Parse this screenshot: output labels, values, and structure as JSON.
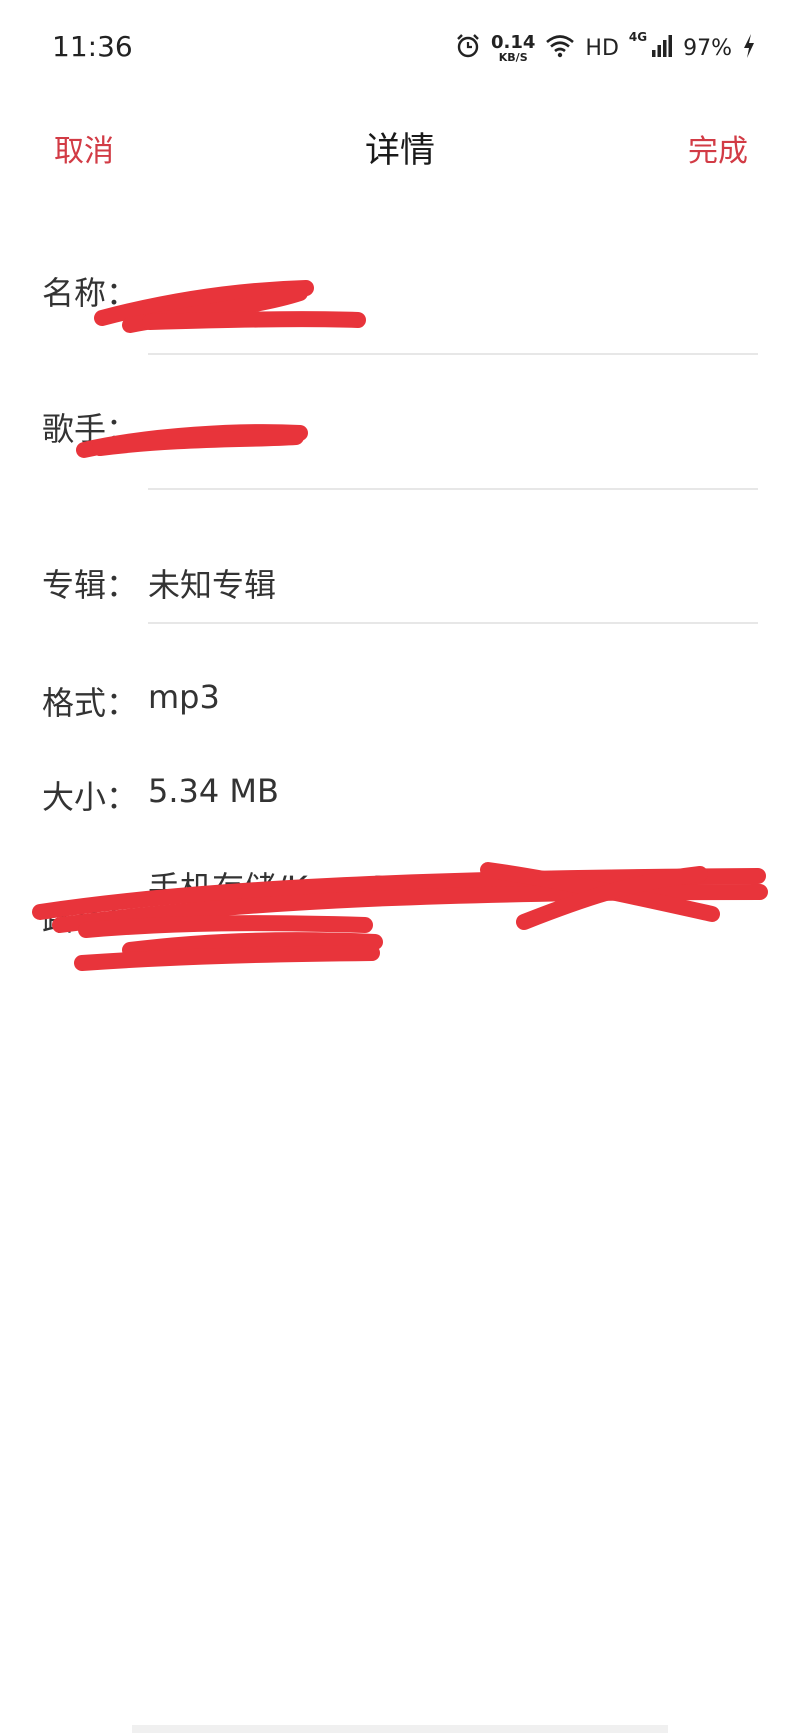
{
  "status_bar": {
    "time": "11:36",
    "speed_value": "0.14",
    "speed_unit": "KB/S",
    "hd": "HD",
    "network": "4G",
    "battery": "97%"
  },
  "nav": {
    "cancel": "取消",
    "title": "详情",
    "done": "完成"
  },
  "fields": {
    "name": {
      "label": "名称：",
      "value": ""
    },
    "artist": {
      "label": "歌手：",
      "value": ""
    },
    "album": {
      "label": "专辑：",
      "value": "未知专辑"
    },
    "format": {
      "label": "格式：",
      "value": "mp3"
    },
    "size": {
      "label": "大小：",
      "value": "5.34 MB"
    },
    "path": {
      "label": "路径：",
      "value": "手机存储/KuwoMusic/mus"
    }
  },
  "colors": {
    "accent": "#d23b45",
    "redaction": "#e8343b",
    "divider": "#e7e7e7"
  }
}
